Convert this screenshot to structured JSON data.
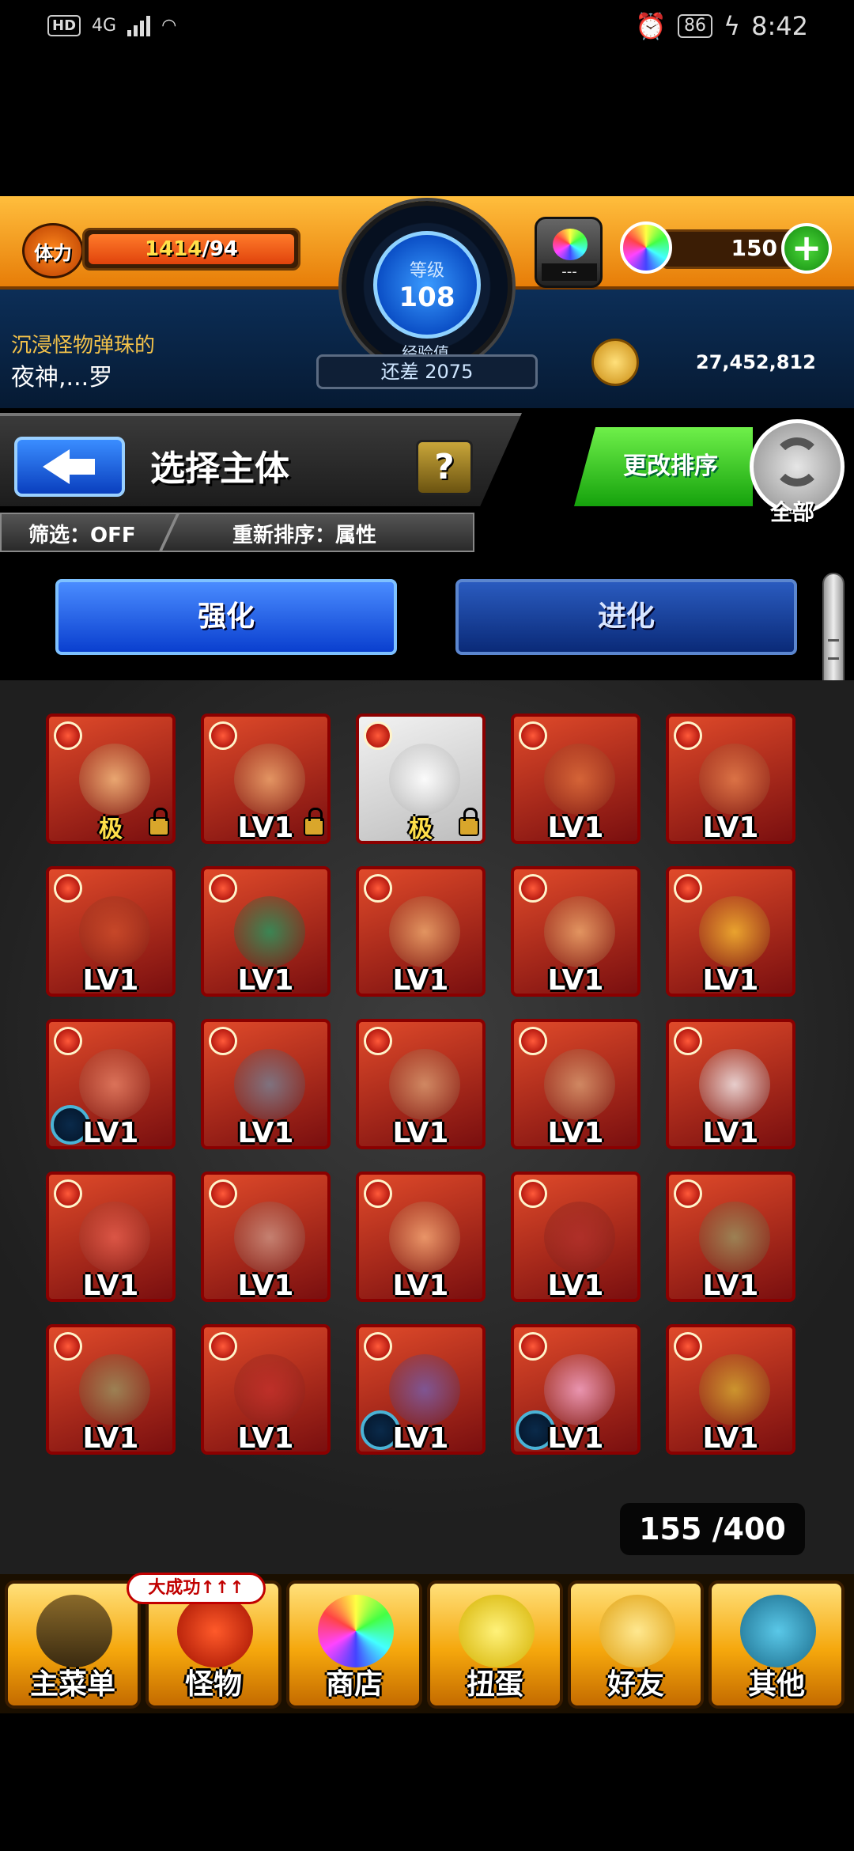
{
  "status_bar": {
    "hd": "HD",
    "network": "4G",
    "battery": "86",
    "time": "8:42"
  },
  "hud": {
    "stamina_label": "体力",
    "stamina_current": "1414",
    "stamina_max": "/94",
    "level_label": "等级",
    "level": "108",
    "orb_case_text": "---",
    "orbs": "150",
    "player_title": "沉浸怪物弹珠的",
    "player_name": "夜神,...罗",
    "exp_label": "经验值",
    "exp_remaining": "还差 2075",
    "gold": "27,452,812"
  },
  "header": {
    "title": "选择主体",
    "help": "?",
    "filter": "筛选：OFF",
    "sort": "重新排序：属性",
    "change_sort": "更改排序",
    "all": "全部"
  },
  "tabs": [
    {
      "label": "强化"
    },
    {
      "label": "进化"
    }
  ],
  "monsters": [
    {
      "label": "极",
      "lock": true
    },
    {
      "label": "LV1",
      "lock": true
    },
    {
      "label": "极",
      "lock": true
    },
    {
      "label": "LV1"
    },
    {
      "label": "LV1"
    },
    {
      "label": "LV1"
    },
    {
      "label": "LV1"
    },
    {
      "label": "LV1"
    },
    {
      "label": "LV1"
    },
    {
      "label": "LV1"
    },
    {
      "label": "LV1"
    },
    {
      "label": "LV1"
    },
    {
      "label": "LV1"
    },
    {
      "label": "LV1"
    },
    {
      "label": "LV1"
    },
    {
      "label": "LV1"
    },
    {
      "label": "LV1"
    },
    {
      "label": "LV1"
    },
    {
      "label": "LV1"
    },
    {
      "label": "LV1"
    },
    {
      "label": "LV1"
    },
    {
      "label": "LV1"
    },
    {
      "label": "LV1"
    },
    {
      "label": "LV1"
    },
    {
      "label": "LV1"
    }
  ],
  "box_count": "155 /400",
  "nav": [
    {
      "label": "主菜单",
      "icon": "home-gate-icon"
    },
    {
      "label": "怪物",
      "icon": "monster-icon",
      "badge": "大成功↑↑↑"
    },
    {
      "label": "商店",
      "icon": "rainbow-orb-icon"
    },
    {
      "label": "扭蛋",
      "icon": "egg-icon"
    },
    {
      "label": "好友",
      "icon": "friends-balloon-icon"
    },
    {
      "label": "其他",
      "icon": "diamond-icon"
    }
  ],
  "colors": {
    "accent_orange": "#f5a70c",
    "accent_blue": "#0a3fcf",
    "accent_green": "#15a20c",
    "fire_red": "#8a0000"
  }
}
